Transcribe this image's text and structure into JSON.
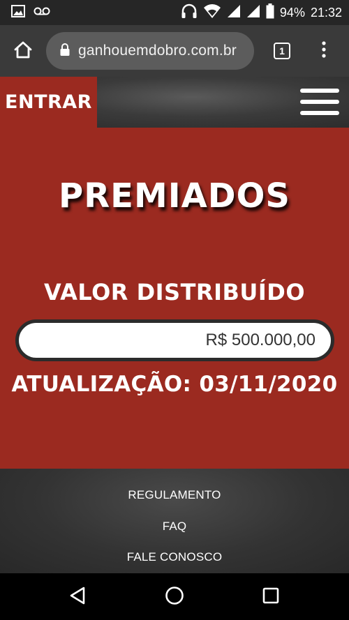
{
  "status_bar": {
    "battery": "94%",
    "time": "21:32",
    "icons": [
      "gallery-icon",
      "voicemail-icon",
      "headset-icon",
      "wifi-icon",
      "signal-icon",
      "battery-icon"
    ]
  },
  "browser": {
    "url": "ganhouemdobro.com.br",
    "tab_count": "1",
    "icons": [
      "home-icon",
      "lock-icon",
      "more-vert-icon"
    ]
  },
  "header": {
    "login_label": "ENTRAR",
    "menu_icon": "hamburger-icon"
  },
  "main": {
    "title": "PREMIADOS",
    "subtitle": "VALOR DISTRIBUÍDO",
    "value": "R$ 500.000,00",
    "update": "ATUALIZAÇÃO: 03/11/2020"
  },
  "footer": {
    "links": [
      "REGULAMENTO",
      "FAQ",
      "FALE CONOSCO"
    ]
  },
  "nav_bar": {
    "icons": [
      "back-icon",
      "home-circle-icon",
      "recents-icon"
    ]
  },
  "colors": {
    "brand_red": "#9b2a20",
    "dark_gray": "#333333"
  }
}
